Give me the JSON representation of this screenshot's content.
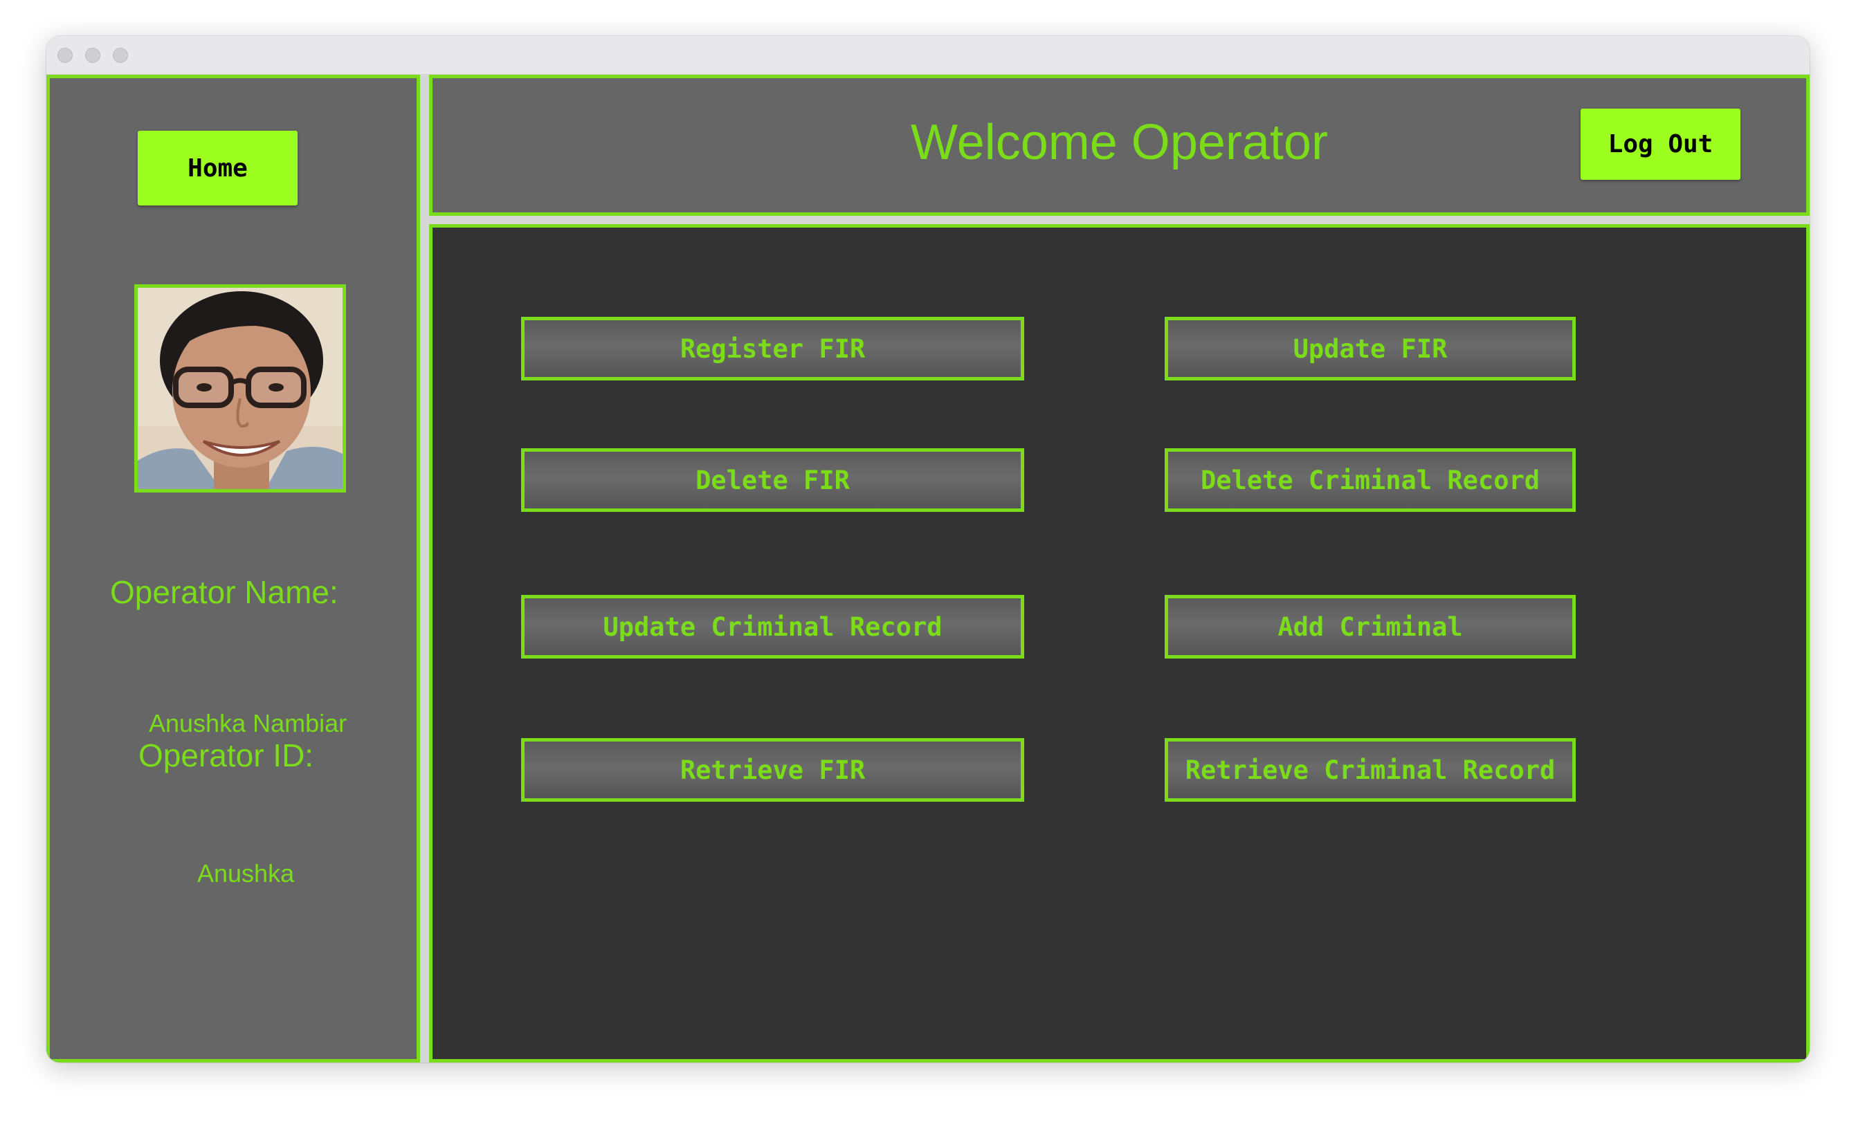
{
  "colors": {
    "accent": "#7bdc1a",
    "button_bright": "#9dff1f",
    "panel": "#666666",
    "main_bg": "#333333"
  },
  "sidebar": {
    "home_label": "Home",
    "avatar": "operator-photo",
    "operator_name_label": "Operator Name:",
    "operator_name_value": "Anushka Nambiar",
    "operator_id_label": "Operator ID:",
    "operator_id_value": "Anushka"
  },
  "header": {
    "title": "Welcome Operator",
    "logout_label": "Log Out"
  },
  "actions": [
    {
      "label": "Register FIR"
    },
    {
      "label": "Update FIR"
    },
    {
      "label": "Delete FIR"
    },
    {
      "label": "Delete Criminal Record"
    },
    {
      "label": "Update Criminal Record"
    },
    {
      "label": "Add Criminal"
    },
    {
      "label": "Retrieve FIR"
    },
    {
      "label": "Retrieve Criminal Record"
    }
  ]
}
